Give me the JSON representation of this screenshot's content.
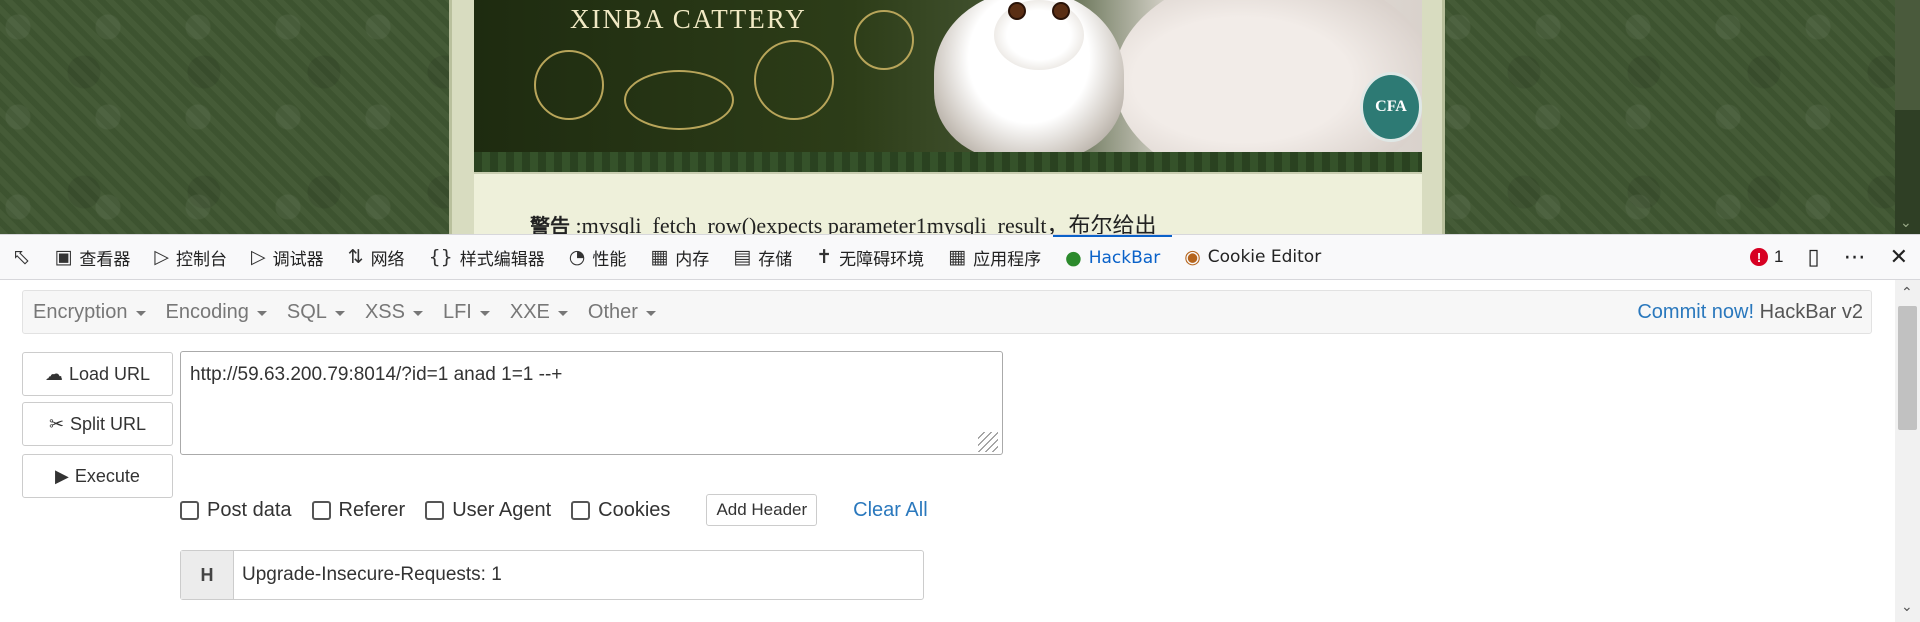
{
  "page": {
    "banner_title": "XINBA  CATTERY",
    "badge_text": "CFA",
    "warning_label": "警告",
    "warning_message": ":mysqli_fetch_row()expects parameter1mysqli_result，布尔给出"
  },
  "devtools": {
    "tabs": [
      {
        "label": "查看器",
        "icon": "inspector-icon"
      },
      {
        "label": "控制台",
        "icon": "console-icon"
      },
      {
        "label": "调试器",
        "icon": "debugger-icon"
      },
      {
        "label": "网络",
        "icon": "network-icon"
      },
      {
        "label": "样式编辑器",
        "icon": "style-editor-icon"
      },
      {
        "label": "性能",
        "icon": "performance-icon"
      },
      {
        "label": "内存",
        "icon": "memory-icon"
      },
      {
        "label": "存储",
        "icon": "storage-icon"
      },
      {
        "label": "无障碍环境",
        "icon": "accessibility-icon"
      },
      {
        "label": "应用程序",
        "icon": "application-icon"
      },
      {
        "label": "HackBar",
        "icon": "hackbar-icon",
        "active": true
      },
      {
        "label": "Cookie Editor",
        "icon": "cookie-icon"
      }
    ],
    "error_count": "1"
  },
  "hackbar": {
    "menu": [
      "Encryption",
      "Encoding",
      "SQL",
      "XSS",
      "LFI",
      "XXE",
      "Other"
    ],
    "commit_link": "Commit now!",
    "version": "HackBar v2",
    "buttons": {
      "load_url": "Load URL",
      "split_url": "Split URL",
      "execute": "Execute"
    },
    "url_value": "http://59.63.200.79:8014/?id=1 anad 1=1 --+",
    "options": [
      "Post data",
      "Referer",
      "User Agent",
      "Cookies"
    ],
    "add_header": "Add Header",
    "clear_all": "Clear All",
    "header": {
      "label": "H",
      "value": "Upgrade-Insecure-Requests: 1"
    }
  },
  "colors": {
    "accent": "#0a62c9",
    "link": "#2a78bd",
    "error": "#d70022"
  }
}
